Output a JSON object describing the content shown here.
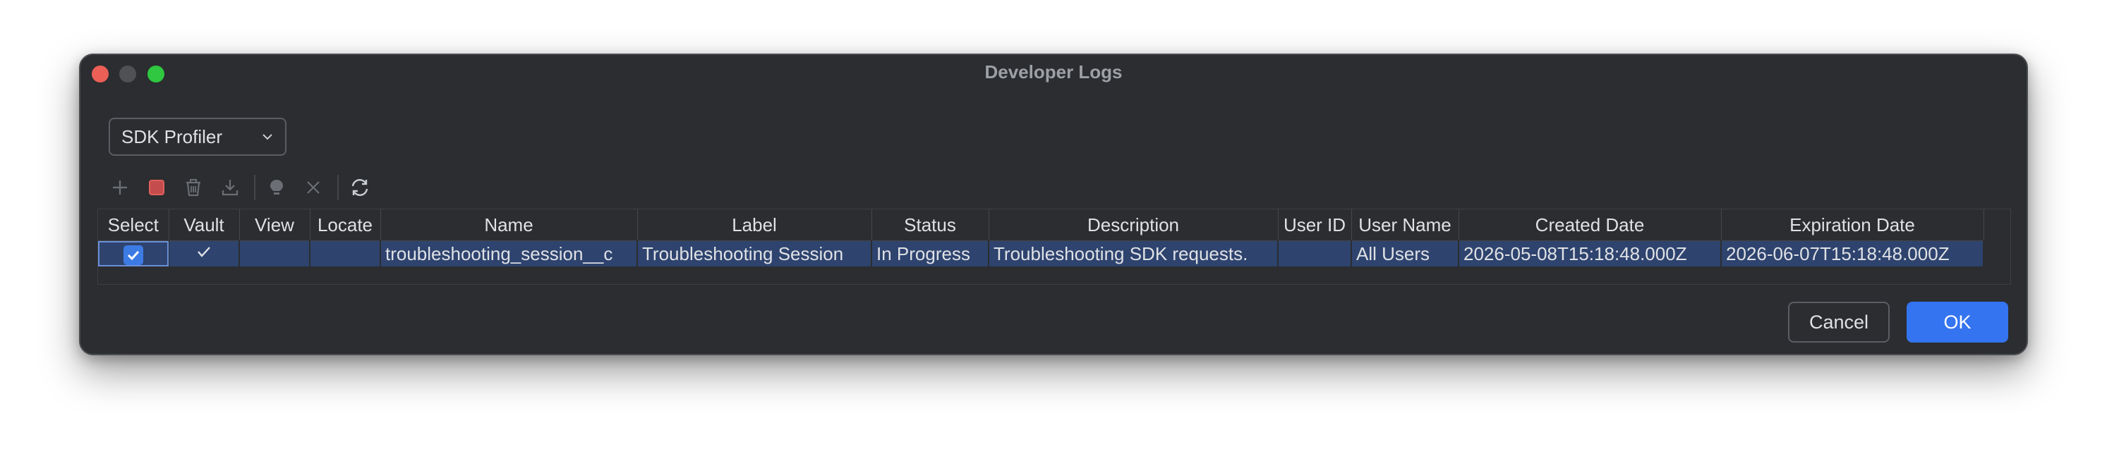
{
  "window": {
    "title": "Developer Logs"
  },
  "dropdown": {
    "selected": "SDK Profiler"
  },
  "toolbar": {
    "icons": [
      "add-icon",
      "stop-icon",
      "trash-icon",
      "download-icon",
      "lightbulb-icon",
      "close-icon",
      "refresh-icon"
    ]
  },
  "table": {
    "columns": [
      "Select",
      "Vault",
      "View",
      "Locate",
      "Name",
      "Label",
      "Status",
      "Description",
      "User ID",
      "User Name",
      "Created Date",
      "Expiration Date"
    ],
    "rows": [
      {
        "select": true,
        "vault": true,
        "view": "",
        "locate": "",
        "name": "troubleshooting_session__c",
        "label": "Troubleshooting Session",
        "status": "In Progress",
        "description": "Troubleshooting SDK requests.",
        "user_id": "",
        "user_name": "All Users",
        "created_date": "2026-05-08T15:18:48.000Z",
        "expiration_date": "2026-06-07T15:18:48.000Z"
      }
    ]
  },
  "buttons": {
    "cancel": "Cancel",
    "ok": "OK"
  },
  "colors": {
    "window_bg": "#2b2d30",
    "selected_row": "#2e436e",
    "accent": "#3574f0"
  }
}
